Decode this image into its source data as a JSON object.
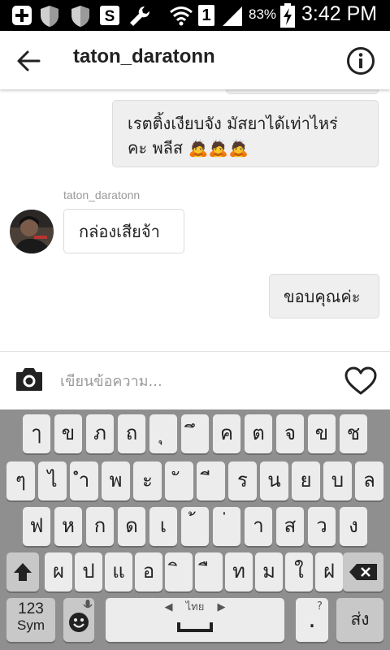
{
  "status_bar": {
    "battery_percent": "83%",
    "sim_slot": "1",
    "time": "3:42 PM"
  },
  "header": {
    "title": "taton_daratonn"
  },
  "messages": [
    {
      "direction": "outgoing",
      "text_line1": "เรตติ้งเงียบจัง มัสยาได้เท่าไหร่",
      "text_line2": "คะ พลีส",
      "emoji": "🙇🙇🙇"
    },
    {
      "direction": "incoming",
      "sender": "taton_daratonn",
      "text": "กล่องเสียจ้า"
    },
    {
      "direction": "outgoing",
      "text": "ขอบคุณค่ะ"
    }
  ],
  "composer": {
    "placeholder": "เขียนข้อความ..."
  },
  "keyboard": {
    "row1": [
      "ๅ",
      "ข",
      "ภ",
      "ถ",
      "ุ",
      "ึ",
      "ค",
      "ต",
      "จ",
      "ข",
      "ช"
    ],
    "row2": [
      "ๆ",
      "ไ",
      "ำ",
      "พ",
      "ะ",
      "ั",
      "ี",
      "ร",
      "น",
      "ย",
      "บ",
      "ล"
    ],
    "row3": [
      "ฟ",
      "ห",
      "ก",
      "ด",
      "เ",
      "้",
      "่",
      "า",
      "ส",
      "ว",
      "ง"
    ],
    "row4": [
      "ผ",
      "ป",
      "แ",
      "อ",
      "ิ",
      "ื",
      "ท",
      "ม",
      "ใ",
      "ฝ"
    ],
    "sym_label_top": "123",
    "sym_label_bottom": "Sym",
    "space_language": "ไทย",
    "period_label": ".",
    "period_sublabel": "?",
    "send_label": "ส่ง"
  },
  "colors": {
    "status_bar": "#000000",
    "outgoing_bubble": "#efefef",
    "keyboard_bg": "#8f8f8f",
    "key_bg": "#ececec"
  }
}
